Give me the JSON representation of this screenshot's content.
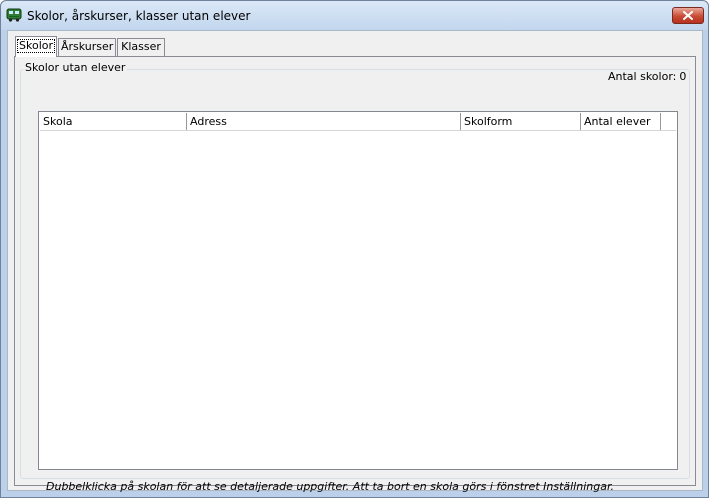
{
  "window": {
    "title": "Skolor, årskurser, klasser utan elever",
    "icon": "bus-icon",
    "close_icon": "close-icon"
  },
  "tabs": [
    {
      "label": "Skolor",
      "active": true
    },
    {
      "label": "Årskurser",
      "active": false
    },
    {
      "label": "Klasser",
      "active": false
    }
  ],
  "group": {
    "title": "Skolor utan elever",
    "count_label": "Antal skolor:",
    "count_value": "0"
  },
  "list": {
    "columns": [
      "Skola",
      "Adress",
      "Skolform",
      "Antal elever"
    ],
    "rows": []
  },
  "hint": "Dubbelklicka på skolan för att se detaljerade uppgifter. Att ta bort en skola görs i fönstret Inställningar.",
  "colors": {
    "titlebar": "#c2d6ee",
    "close_button": "#c94a35",
    "client_background": "#f0f0f0"
  }
}
